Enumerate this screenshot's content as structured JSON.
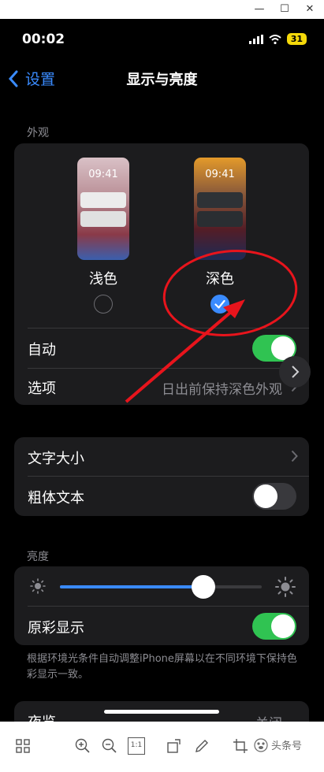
{
  "status": {
    "time": "00:02",
    "battery": "31"
  },
  "nav": {
    "back_label": "设置",
    "title": "显示与亮度"
  },
  "appearance": {
    "header": "外观",
    "light": {
      "time": "09:41",
      "label": "浅色",
      "selected": false
    },
    "dark": {
      "time": "09:41",
      "label": "深色",
      "selected": true
    },
    "auto_label": "自动",
    "auto_on": true,
    "options_label": "选项",
    "options_value": "日出前保持深色外观"
  },
  "text": {
    "size_label": "文字大小",
    "bold_label": "粗体文本",
    "bold_on": false
  },
  "brightness": {
    "header": "亮度",
    "level": 0.71,
    "true_tone_label": "原彩显示",
    "true_tone_on": true,
    "footnote": "根据环境光条件自动调整iPhone屏幕以在不同环境下保持色彩显示一致。"
  },
  "night": {
    "label": "夜览",
    "value": "关闭"
  },
  "watermark": "头条号",
  "colors": {
    "accent": "#3a8bff",
    "toggle_on": "#30c352",
    "annotation": "#e8141c"
  },
  "toolbar": {
    "fit_label": "1:1"
  }
}
